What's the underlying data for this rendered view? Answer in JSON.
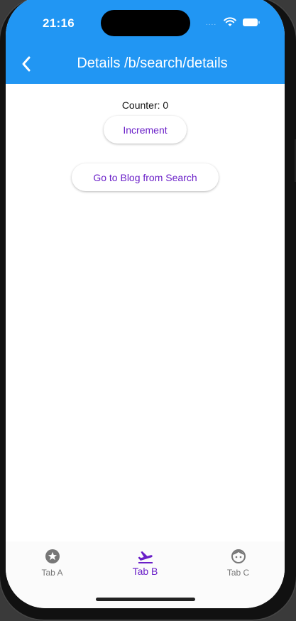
{
  "status_bar": {
    "time": "21:16",
    "signal": "....",
    "icons": [
      "wifi-icon",
      "battery-icon"
    ]
  },
  "app_bar": {
    "title": "Details /b/search/details",
    "back_icon": "chevron-left-icon",
    "color": "#2196F3"
  },
  "content": {
    "counter_text": "Counter: 0",
    "increment_label": "Increment",
    "go_to_blog_label": "Go to Blog from Search"
  },
  "bottom_nav": {
    "tabs": [
      {
        "label": "Tab A",
        "icon": "star-circle-icon",
        "active": false
      },
      {
        "label": "Tab B",
        "icon": "flight-takeoff-icon",
        "active": true
      },
      {
        "label": "Tab C",
        "icon": "face-icon",
        "active": false
      }
    ],
    "active_color": "#6A1FC8"
  }
}
